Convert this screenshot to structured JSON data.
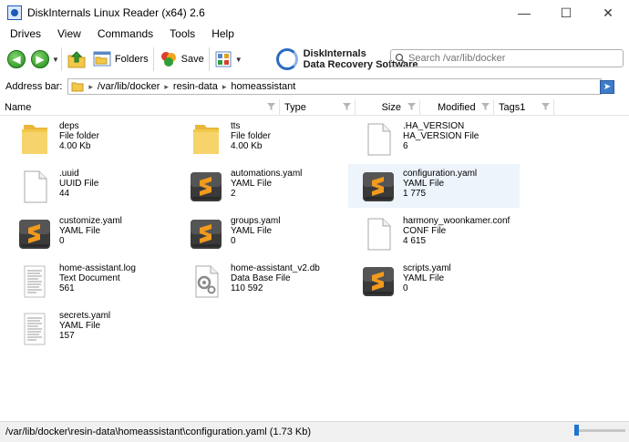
{
  "window": {
    "title": "DiskInternals Linux Reader (x64) 2.6",
    "minimize": "—",
    "maximize": "☐",
    "close": "✕"
  },
  "menu": [
    "Drives",
    "View",
    "Commands",
    "Tools",
    "Help"
  ],
  "toolbar": {
    "folders_label": "Folders",
    "save_label": "Save",
    "brand_line1": "DiskInternals",
    "brand_line2": "Data Recovery Software",
    "search_placeholder": "Search /var/lib/docker"
  },
  "address": {
    "label": "Address bar:",
    "crumbs": [
      "/var/lib/docker",
      "resin-data",
      "homeassistant"
    ]
  },
  "columns": {
    "name": "Name",
    "type": "Type",
    "size": "Size",
    "modified": "Modified",
    "tags": "Tags1"
  },
  "files": [
    {
      "name": "deps",
      "type": "File folder",
      "size": "4.00 Kb",
      "icon": "folder-icon"
    },
    {
      "name": "tts",
      "type": "File folder",
      "size": "4.00 Kb",
      "icon": "folder-icon"
    },
    {
      "name": ".HA_VERSION",
      "type": "HA_VERSION File",
      "size": "6",
      "icon": "document-icon"
    },
    {
      "name": ".uuid",
      "type": "UUID File",
      "size": "44",
      "icon": "document-icon"
    },
    {
      "name": "automations.yaml",
      "type": "YAML File",
      "size": "2",
      "icon": "sublime-icon"
    },
    {
      "name": "configuration.yaml",
      "type": "YAML File",
      "size": "1 775",
      "icon": "sublime-icon"
    },
    {
      "name": "customize.yaml",
      "type": "YAML File",
      "size": "0",
      "icon": "sublime-icon"
    },
    {
      "name": "groups.yaml",
      "type": "YAML File",
      "size": "0",
      "icon": "sublime-icon"
    },
    {
      "name": "harmony_woonkamer.conf",
      "type": "CONF File",
      "size": "4 615",
      "icon": "document-icon"
    },
    {
      "name": "home-assistant.log",
      "type": "Text Document",
      "size": "561",
      "icon": "text-document-icon"
    },
    {
      "name": "home-assistant_v2.db",
      "type": "Data Base File",
      "size": "110 592",
      "icon": "database-gear-icon"
    },
    {
      "name": "scripts.yaml",
      "type": "YAML File",
      "size": "0",
      "icon": "sublime-icon"
    },
    {
      "name": "secrets.yaml",
      "type": "YAML File",
      "size": "157",
      "icon": "text-document-icon"
    }
  ],
  "status": {
    "text": "/var/lib/docker\\resin-data\\homeassistant\\configuration.yaml (1.73 Kb)"
  },
  "colors": {
    "accent": "#1f74cf",
    "selection": "#eef4fc",
    "folder": "#f2c84b"
  }
}
